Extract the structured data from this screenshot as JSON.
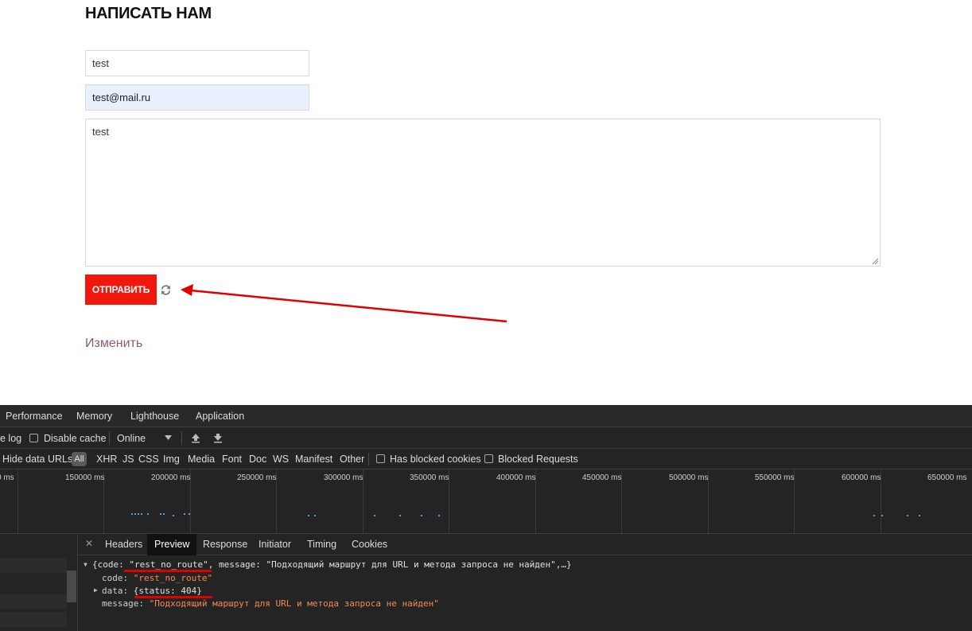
{
  "form": {
    "title": "НАПИСАТЬ НАМ",
    "name_value": "test",
    "email_value": "test@mail.ru",
    "message_value": "test",
    "submit_label": "ОТПРАВИТЬ",
    "edit_link": "Изменить",
    "accent_color": "#f0170f",
    "annotation_color": "#e00000"
  },
  "devtools": {
    "tabs": [
      "Performance",
      "Memory",
      "Lighthouse",
      "Application"
    ],
    "toolbar": {
      "preserve_log_fragment": "e log",
      "disable_cache": "Disable cache",
      "throttle": "Online"
    },
    "filters": {
      "hide_data_urls": "Hide data URLs",
      "all": "All",
      "types": [
        "XHR",
        "JS",
        "CSS",
        "Img",
        "Media",
        "Font",
        "Doc",
        "WS",
        "Manifest",
        "Other"
      ],
      "has_blocked_cookies": "Has blocked cookies",
      "blocked_requests": "Blocked Requests"
    },
    "timeline_ticks": [
      "0 ms",
      "150000 ms",
      "200000 ms",
      "250000 ms",
      "300000 ms",
      "350000 ms",
      "400000 ms",
      "450000 ms",
      "500000 ms",
      "550000 ms",
      "600000 ms",
      "650000 ms"
    ],
    "detail_tabs": [
      "Headers",
      "Preview",
      "Response",
      "Initiator",
      "Timing",
      "Cookies"
    ],
    "active_detail_tab": "Preview",
    "preview": {
      "summary_open": "{code: ",
      "summary_code": "\"rest_no_route\"",
      "summary_rest": ", message: \"Подходящий маршрут для URL и метода запроса не найден\",…}",
      "code_key": "code: ",
      "code_value": "\"rest_no_route\"",
      "data_key": "data: ",
      "data_value": "{status: 404}",
      "message_key": "message: ",
      "message_value": "\"Подходящий маршрут для URL и метода запроса не найден\""
    }
  }
}
